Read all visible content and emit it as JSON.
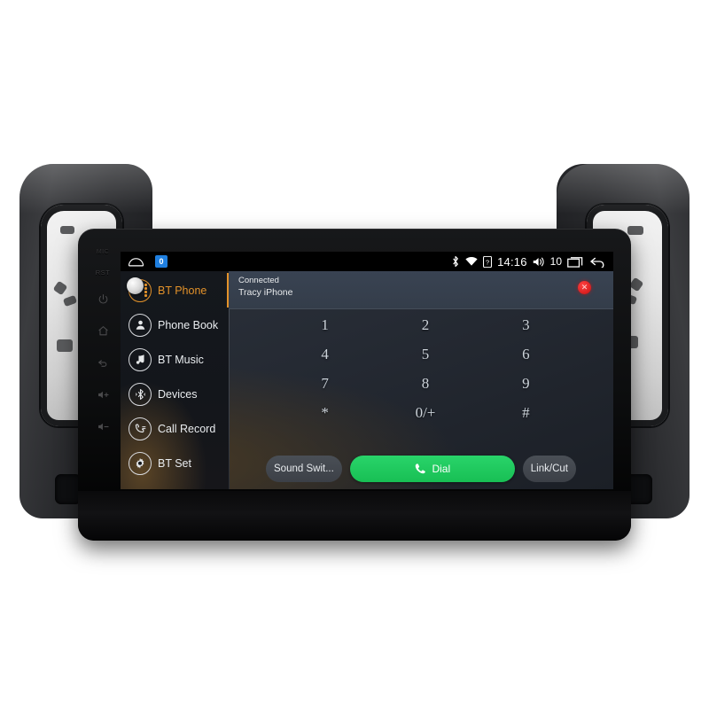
{
  "device": {
    "type": "car-head-unit",
    "hard_keys": [
      {
        "name": "mic",
        "label": "MIC"
      },
      {
        "name": "reset",
        "label": "RST"
      },
      {
        "name": "power",
        "label": ""
      },
      {
        "name": "home",
        "label": ""
      },
      {
        "name": "back",
        "label": ""
      },
      {
        "name": "volume-up",
        "label": ""
      },
      {
        "name": "volume-down",
        "label": ""
      }
    ]
  },
  "statusbar": {
    "home_icon": "home-icon",
    "badge_text": "0",
    "bluetooth_icon": "bluetooth-icon",
    "wifi_icon": "wifi-icon",
    "sim_icon": "sim-card-icon",
    "time": "14:16",
    "volume_icon": "volume-icon",
    "volume_level": "10",
    "recents_icon": "recents-icon",
    "back_icon": "back-icon"
  },
  "sidebar": {
    "items": [
      {
        "label": "BT Phone",
        "icon": "bt-phone-icon",
        "active": true
      },
      {
        "label": "Phone Book",
        "icon": "contact-icon",
        "active": false
      },
      {
        "label": "BT Music",
        "icon": "music-note-icon",
        "active": false
      },
      {
        "label": "Devices",
        "icon": "bluetooth-icon",
        "active": false
      },
      {
        "label": "Call Record",
        "icon": "call-record-icon",
        "active": false
      },
      {
        "label": "BT Set",
        "icon": "gear-icon",
        "active": false
      }
    ]
  },
  "connection": {
    "status": "Connected",
    "device_name": "Tracy iPhone",
    "hangup_icon": "disconnect-icon",
    "hangup_glyph": "✕"
  },
  "keypad": {
    "keys": [
      "1",
      "2",
      "3",
      "4",
      "5",
      "6",
      "7",
      "8",
      "9",
      "*",
      "0/+",
      "#"
    ]
  },
  "actions": {
    "sound_switch": "Sound Swit...",
    "dial": "Dial",
    "dial_icon": "phone-handset-icon",
    "link_cut": "Link/Cut"
  },
  "colors": {
    "accent_orange": "#e3922a",
    "dial_green": "#21c95f",
    "hangup_red": "#d91f1f",
    "badge_blue": "#1f7fe0",
    "panel_dark": "#252a33"
  }
}
